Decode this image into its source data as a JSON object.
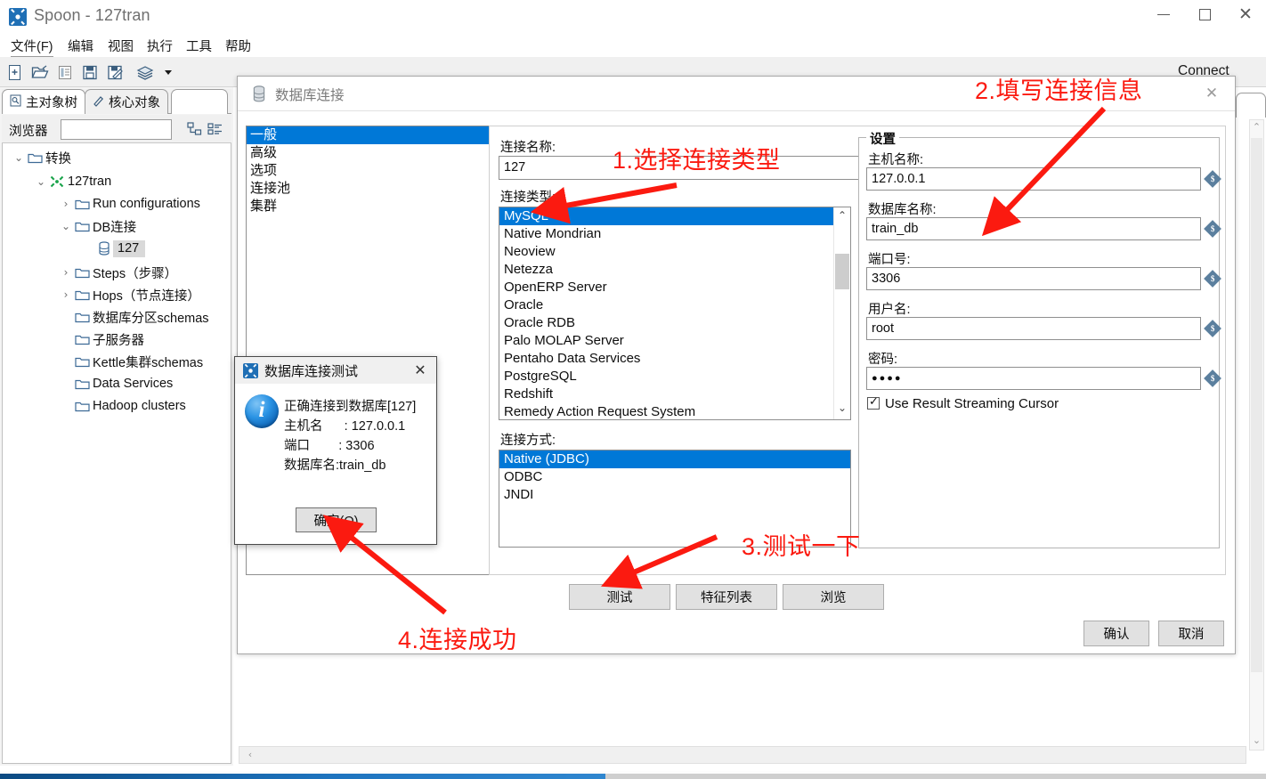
{
  "window": {
    "title": "Spoon - 127tran",
    "icon": "spoon-app-icon",
    "controls": {
      "minimize": "minimize-icon",
      "maximize": "maximize-icon",
      "close": "close-icon"
    }
  },
  "menubar": {
    "items": [
      {
        "label": "文件(F)",
        "underline": true
      },
      {
        "label": "编辑",
        "underline": false
      },
      {
        "label": "视图",
        "underline": false
      },
      {
        "label": "执行",
        "underline": false
      },
      {
        "label": "工具",
        "underline": false
      },
      {
        "label": "帮助",
        "underline": false
      }
    ]
  },
  "toolbar": {
    "items": [
      {
        "name": "new-file-icon"
      },
      {
        "name": "open-folder-icon"
      },
      {
        "name": "explorer-icon"
      },
      {
        "name": "save-icon"
      },
      {
        "name": "save-as-icon"
      },
      {
        "name": "layers-icon"
      },
      {
        "name": "dropdown-arrow-icon"
      }
    ]
  },
  "left_panel": {
    "tabs": [
      {
        "label": "主对象树",
        "icon": "tree-view-icon",
        "active": true
      },
      {
        "label": "核心对象",
        "icon": "pencil-icon",
        "active": false
      }
    ],
    "browser": {
      "label": "浏览器",
      "value": "",
      "placeholder": "",
      "buttons": [
        {
          "name": "expand-tree-icon"
        },
        {
          "name": "collapse-tree-icon"
        }
      ]
    },
    "tree": [
      {
        "label": "转换",
        "indent": 0,
        "chevron": "down",
        "icon": "folder-icon",
        "selected": false
      },
      {
        "label": "127tran",
        "indent": 1,
        "chevron": "down",
        "icon": "transformation-icon",
        "selected": false
      },
      {
        "label": "Run configurations",
        "indent": 2,
        "chevron": "right",
        "icon": "folder-icon",
        "selected": false
      },
      {
        "label": "DB连接",
        "indent": 2,
        "chevron": "down",
        "icon": "folder-icon",
        "selected": false
      },
      {
        "label": "127",
        "indent": 3,
        "chevron": "none",
        "icon": "database-icon",
        "selected": true
      },
      {
        "label": "Steps（步骤）",
        "indent": 2,
        "chevron": "right",
        "icon": "folder-icon",
        "selected": false
      },
      {
        "label": "Hops（节点连接）",
        "indent": 2,
        "chevron": "right",
        "icon": "folder-icon",
        "selected": false
      },
      {
        "label": "数据库分区schemas",
        "indent": 2,
        "chevron": "none",
        "icon": "folder-icon",
        "selected": false
      },
      {
        "label": "子服务器",
        "indent": 2,
        "chevron": "none",
        "icon": "folder-icon",
        "selected": false
      },
      {
        "label": "Kettle集群schemas",
        "indent": 2,
        "chevron": "none",
        "icon": "folder-icon",
        "selected": false
      },
      {
        "label": "Data Services",
        "indent": 2,
        "chevron": "none",
        "icon": "folder-icon",
        "selected": false
      },
      {
        "label": "Hadoop clusters",
        "indent": 2,
        "chevron": "none",
        "icon": "folder-icon",
        "selected": false
      }
    ]
  },
  "canvas": {
    "connect_label": "Connect"
  },
  "db_dialog": {
    "title": "数据库连接",
    "title_icon": "database-icon",
    "close_icon": "close-icon",
    "categories": [
      {
        "label": "一般",
        "selected": true
      },
      {
        "label": "高级",
        "selected": false
      },
      {
        "label": "选项",
        "selected": false
      },
      {
        "label": "连接池",
        "selected": false
      },
      {
        "label": "集群",
        "selected": false
      }
    ],
    "connection_name": {
      "label": "连接名称:",
      "value": "127"
    },
    "connection_type": {
      "label": "连接类型:",
      "selected": "MySQL",
      "options": [
        "MySQL",
        "Native Mondrian",
        "Neoview",
        "Netezza",
        "OpenERP Server",
        "Oracle",
        "Oracle RDB",
        "Palo MOLAP Server",
        "Pentaho Data Services",
        "PostgreSQL",
        "Redshift",
        "Remedy Action Request System"
      ]
    },
    "access_method": {
      "label": "连接方式:",
      "selected": "Native (JDBC)",
      "options": [
        "Native (JDBC)",
        "ODBC",
        "JNDI"
      ]
    },
    "settings": {
      "group_title": "设置",
      "fields": [
        {
          "label": "主机名称:",
          "value": "127.0.0.1",
          "name": "hostname"
        },
        {
          "label": "数据库名称:",
          "value": "train_db",
          "name": "database-name"
        },
        {
          "label": "端口号:",
          "value": "3306",
          "name": "port"
        },
        {
          "label": "用户名:",
          "value": "root",
          "name": "username"
        },
        {
          "label": "密码:",
          "value": "●●●●",
          "name": "password"
        }
      ],
      "checkbox": {
        "label": "Use Result Streaming Cursor",
        "checked": true
      }
    },
    "action_buttons": [
      {
        "label": "测试",
        "name": "test-button"
      },
      {
        "label": "特征列表",
        "name": "feature-list-button"
      },
      {
        "label": "浏览",
        "name": "explore-button"
      }
    ],
    "footer_buttons": [
      {
        "label": "确认",
        "name": "ok-button"
      },
      {
        "label": "取消",
        "name": "cancel-button"
      }
    ]
  },
  "test_dialog": {
    "title": "数据库连接测试",
    "icon": "spoon-app-icon",
    "close_icon": "close-icon",
    "messages": [
      "正确连接到数据库[127]",
      "主机名      : 127.0.0.1",
      "端口        : 3306",
      "数据库名:train_db"
    ],
    "ok_button": "确定(O)"
  },
  "annotations": [
    {
      "text": "1.选择连接类型",
      "name": "annotation-step-1"
    },
    {
      "text": "2.填写连接信息",
      "name": "annotation-step-2"
    },
    {
      "text": "3.测试一下",
      "name": "annotation-step-3"
    },
    {
      "text": "4.连接成功",
      "name": "annotation-step-4"
    }
  ],
  "colors": {
    "selection_blue": "#0078d7",
    "annotation_red": "#fb1a10",
    "icon_blue": "#1f6fb5"
  }
}
